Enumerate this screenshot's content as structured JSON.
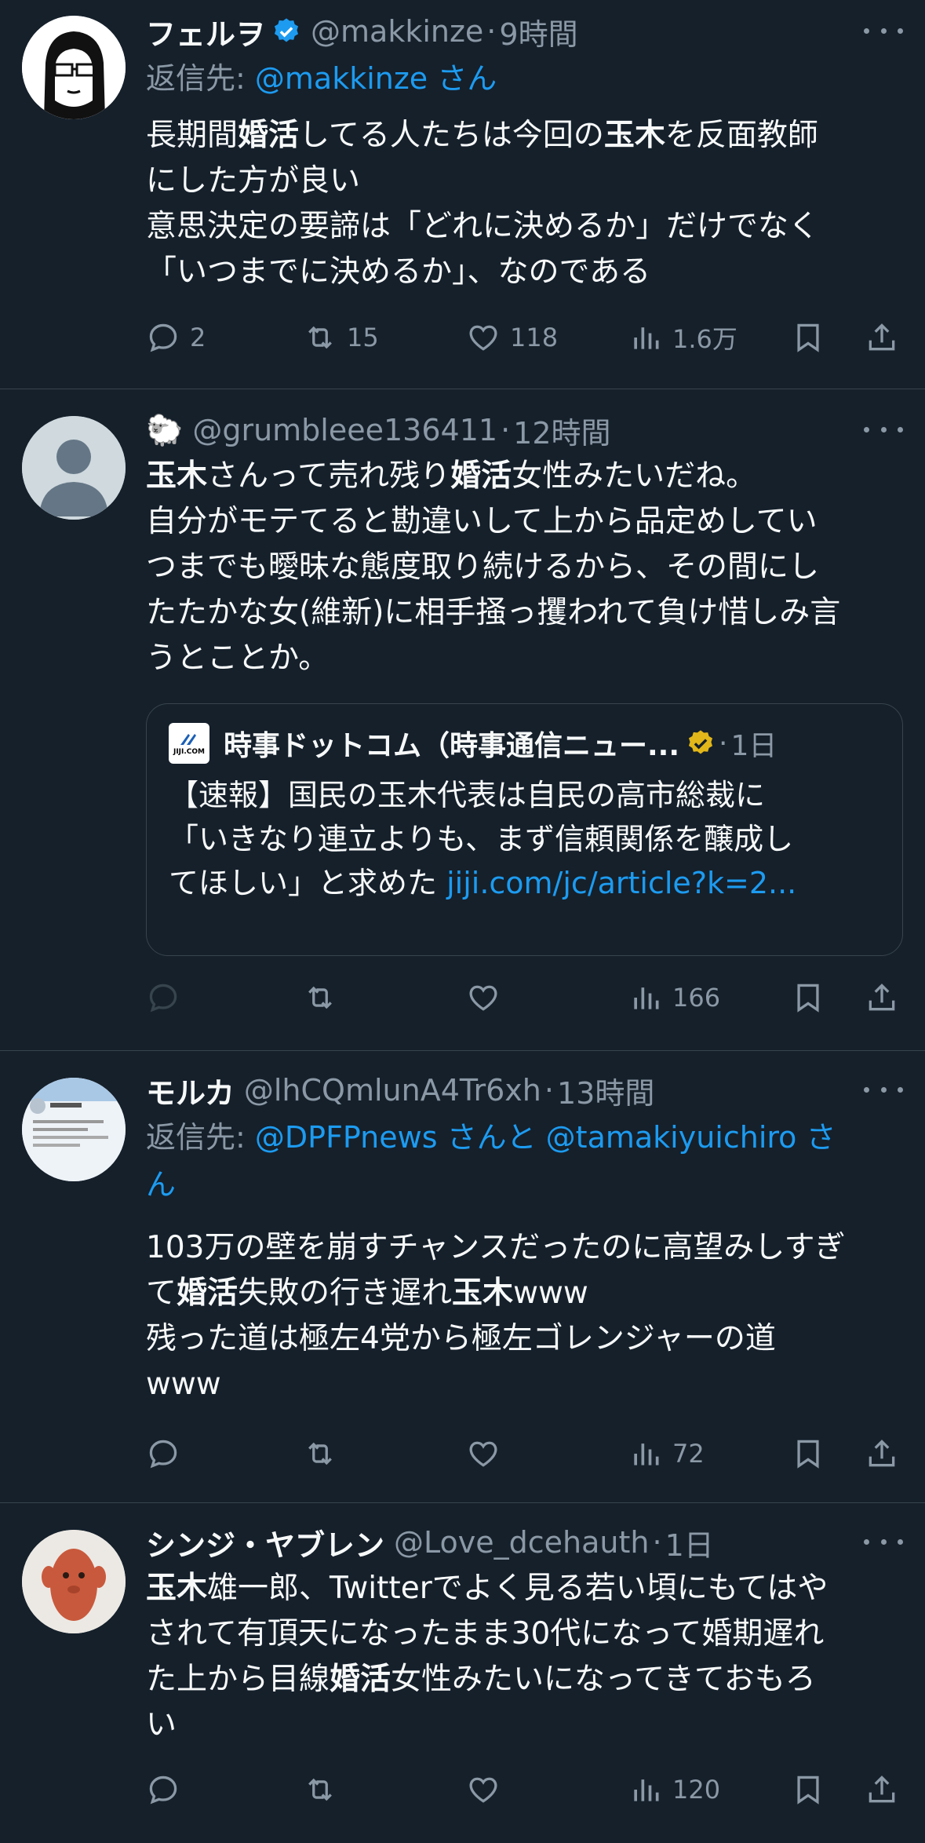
{
  "colors": {
    "background": "#15202b",
    "text": "#f7f9f9",
    "secondary": "#8b98a5",
    "link": "#1d9bf0",
    "border": "#38444d",
    "verified_blue": "#1d9bf0",
    "verified_gold": "#e2b719"
  },
  "tweets": [
    {
      "name": "フェルヲ",
      "verified": "blue",
      "handle": "@makkinze",
      "time": "9時間",
      "reply_prefix": "返信先: ",
      "reply_to": "@makkinze さん",
      "text_parts": [
        "長期間",
        "婚活",
        "してる人たちは今回の",
        "玉木",
        "を反面教師\nにした方が良い\n意思決定の要諦は「どれに決めるか」だけでなく\n「いつまでに決めるか」、なのである"
      ],
      "replies": "2",
      "retweets": "15",
      "likes": "118",
      "views": "1.6万"
    },
    {
      "name": "🐑",
      "handle": "@grumbleee136411",
      "time": "12時間",
      "text_parts": [
        "玉木",
        "さんって売れ残り",
        "婚活",
        "女性みたいだね。\n自分がモテてると勘違いして上から品定めしてい\nつまでも曖昧な態度取り続けるから、その間にし\nたたかな女(維新)に相手掻っ攫われて負け惜しみ言\nうとことか。"
      ],
      "quote": {
        "logo_text": "JIJI.COM",
        "name": "時事ドットコム（時事通信ニュー...",
        "verified": "gold",
        "time": "1日",
        "text": "【速報】国民の玉木代表は自民の高市総裁に\n「いきなり連立よりも、まず信頼関係を醸成し\nてほしい」と求めた ",
        "url": "jiji.com/jc/article?k=2..."
      },
      "replies": "",
      "retweets": "",
      "likes": "",
      "views": "166"
    },
    {
      "name": "モルカ",
      "handle": "@lhCQmlunA4Tr6xh",
      "time": "13時間",
      "reply_prefix": "返信先: ",
      "reply_to_1": "@DPFPnews さんと @tamakiyuichiro さ",
      "reply_to_2": "ん",
      "text_parts": [
        "103万の壁を崩すチャンスだったのに高望みしすぎ\nて",
        "婚活",
        "失敗の行き遅れ",
        "玉木",
        "www\n残った道は極左4党から極左ゴレンジャーの道\nwww"
      ],
      "replies": "",
      "retweets": "",
      "likes": "",
      "views": "72"
    },
    {
      "name": "シンジ・ヤブレン",
      "handle": "@Love_dcehauth",
      "time": "1日",
      "text_parts": [
        "玉木",
        "雄一郎、Twitterでよく見る若い頃にもてはや\nされて有頂天になったまま30代になって婚期遅れ\nた上から目線",
        "婚活",
        "女性みたいになってきておもろ\nい"
      ],
      "replies": "",
      "retweets": "",
      "likes": "",
      "views": "120"
    }
  ]
}
